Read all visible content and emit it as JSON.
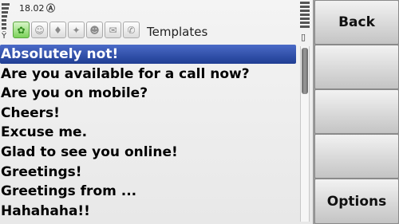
{
  "status": {
    "time": "18.02",
    "time_icon": "Ⓐ",
    "signal_icon": "signal-strength-icon",
    "battery_icon": "battery-level-icon",
    "active_tab_index": 0
  },
  "view": {
    "title": "Templates"
  },
  "tabs": [
    {
      "icon": "flower-icon",
      "glyph": "✿"
    },
    {
      "icon": "person-icon",
      "glyph": "☺"
    },
    {
      "icon": "bulb-icon",
      "glyph": "♦"
    },
    {
      "icon": "running-icon",
      "glyph": "✦"
    },
    {
      "icon": "smiley-icon",
      "glyph": "☻"
    },
    {
      "icon": "chat-bubble-icon",
      "glyph": "✉"
    },
    {
      "icon": "phone-person-icon",
      "glyph": "✆"
    }
  ],
  "list": {
    "selected_index": 0,
    "items": [
      "Absolutely not!",
      "Are you available for a call now?",
      "Are you on mobile?",
      "Cheers!",
      "Excuse me.",
      "Glad to see you online!",
      "Greetings!",
      "Greetings from ...",
      "Hahahaha!!"
    ]
  },
  "softkeys": {
    "top": "Back",
    "bottom": "Options"
  }
}
